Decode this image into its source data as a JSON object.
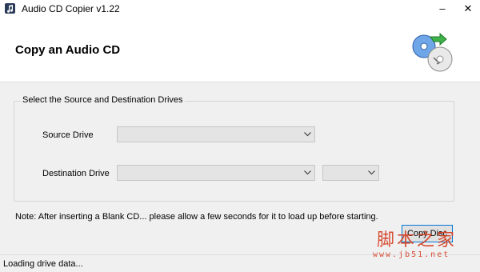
{
  "window": {
    "title": "Audio CD Copier v1.22",
    "icon": "music-note-icon",
    "controls": {
      "minimize": "–",
      "close": "✕"
    }
  },
  "header": {
    "title": "Copy an Audio CD",
    "icon": "disc-copy-icon"
  },
  "drives_group": {
    "label": "Select the Source and Destination Drives",
    "source_label": "Source Drive",
    "source_value": "",
    "destination_label": "Destination Drive",
    "destination_value": "",
    "speed_value": ""
  },
  "note": "Note: After inserting a Blank CD... please allow a few seconds for it to load up before starting.",
  "buttons": {
    "copy": "Copy Disc"
  },
  "status": {
    "text": "Loading drive data..."
  },
  "watermark": {
    "site_name": "脚本之家",
    "url": "www.jb51.net"
  },
  "colors": {
    "focus_border": "#0078d7",
    "watermark": "#d33b1d",
    "disabled_combo": "#e4e4e4"
  }
}
